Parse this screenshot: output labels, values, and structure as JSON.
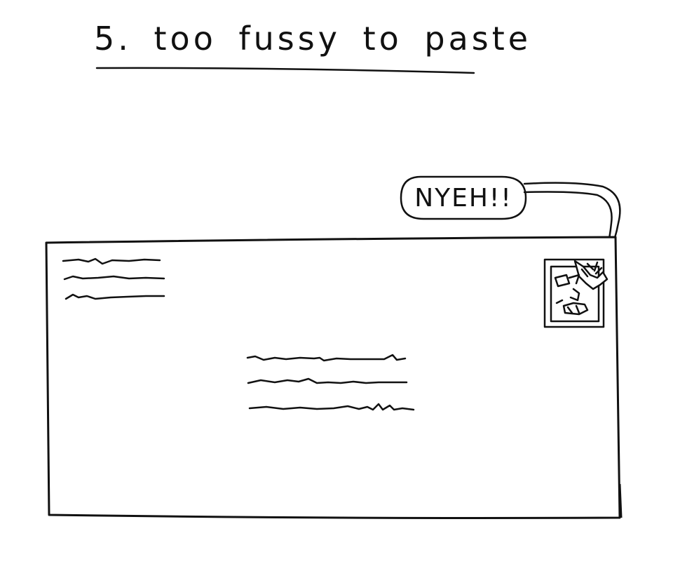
{
  "title": "5. too fussy to paste",
  "speech_bubble": {
    "text": "NYEH!!"
  },
  "colors": {
    "ink": "#111111",
    "paper": "#ffffff"
  }
}
